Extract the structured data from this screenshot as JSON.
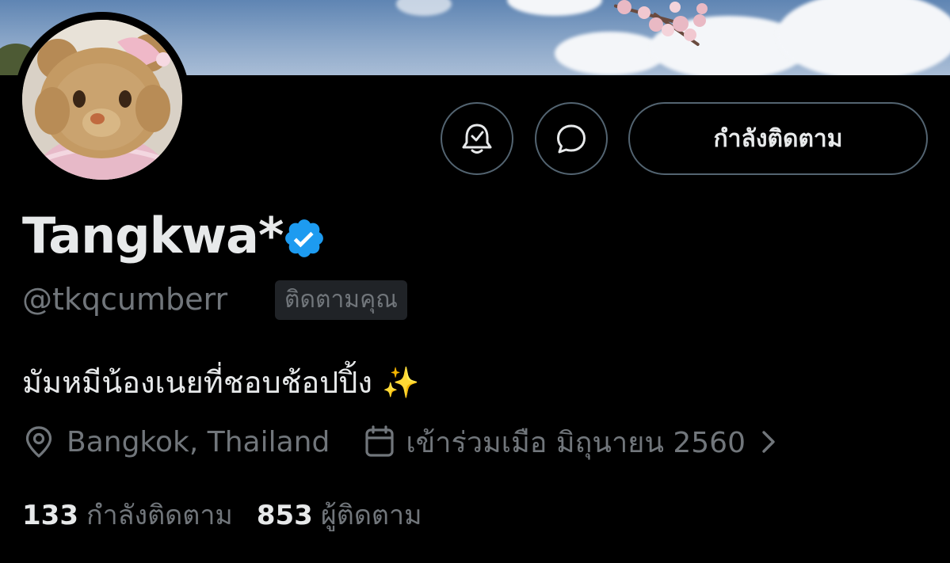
{
  "header_actions": {
    "notify_icon": "bell-check-icon",
    "message_icon": "message-bubble-icon",
    "follow_label": "กำลังติดตาม"
  },
  "profile": {
    "display_name": "Tangkwa*",
    "verified": true,
    "verified_color": "#1d9bf0",
    "handle": "@tkqcumberr",
    "follows_you_label": "ติดตามคุณ",
    "bio": "มัมหมีน้องเนยที่ชอบช้อปปิ้ง ✨",
    "location": "Bangkok, Thailand",
    "joined": "เข้าร่วมเมือ มิถุนายน 2560"
  },
  "stats": {
    "following_count": "133",
    "following_label": "กำลังติดตาม",
    "followers_count": "853",
    "followers_label": "ผู้ติดตาม"
  }
}
